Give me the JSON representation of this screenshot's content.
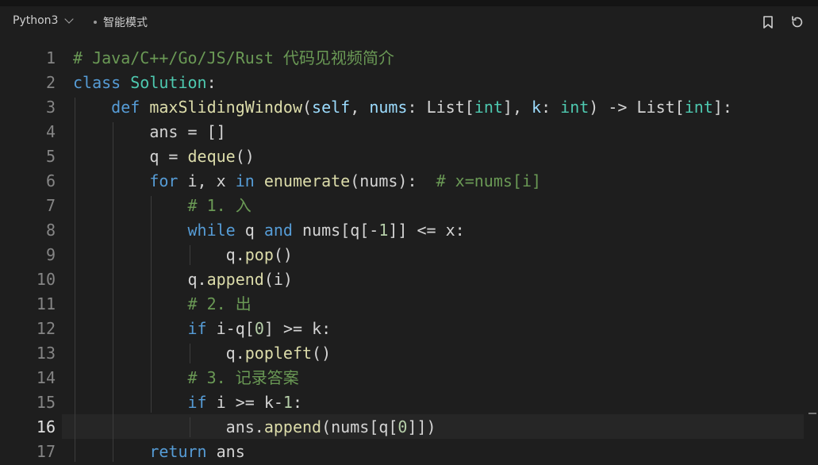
{
  "toolbar": {
    "language": "Python3",
    "mode": "智能模式",
    "bookmark_icon": "bookmark-icon",
    "reset_icon": "reset-icon"
  },
  "editor": {
    "active_line": 16,
    "lines": [
      {
        "n": "1",
        "tokens": [
          {
            "t": "# Java/C++/Go/JS/Rust 代码见视频简介",
            "c": "cm"
          }
        ]
      },
      {
        "n": "2",
        "tokens": [
          {
            "t": "class ",
            "c": "kw"
          },
          {
            "t": "Solution",
            "c": "cls"
          },
          {
            "t": ":",
            "c": ""
          }
        ]
      },
      {
        "n": "3",
        "tokens": [
          {
            "t": "    ",
            "c": ""
          },
          {
            "t": "def ",
            "c": "kw"
          },
          {
            "t": "maxSlidingWindow",
            "c": "fn"
          },
          {
            "t": "(",
            "c": ""
          },
          {
            "t": "self",
            "c": "self"
          },
          {
            "t": ", ",
            "c": ""
          },
          {
            "t": "nums",
            "c": "param"
          },
          {
            "t": ": List[",
            "c": ""
          },
          {
            "t": "int",
            "c": "typ"
          },
          {
            "t": "], ",
            "c": ""
          },
          {
            "t": "k",
            "c": "param"
          },
          {
            "t": ": ",
            "c": ""
          },
          {
            "t": "int",
            "c": "typ"
          },
          {
            "t": ") -> List[",
            "c": ""
          },
          {
            "t": "int",
            "c": "typ"
          },
          {
            "t": "]:",
            "c": ""
          }
        ]
      },
      {
        "n": "4",
        "tokens": [
          {
            "t": "        ans = []",
            "c": ""
          }
        ]
      },
      {
        "n": "5",
        "tokens": [
          {
            "t": "        q = ",
            "c": ""
          },
          {
            "t": "deque",
            "c": "fn"
          },
          {
            "t": "()",
            "c": ""
          }
        ]
      },
      {
        "n": "6",
        "tokens": [
          {
            "t": "        ",
            "c": ""
          },
          {
            "t": "for",
            "c": "kw"
          },
          {
            "t": " i, x ",
            "c": ""
          },
          {
            "t": "in",
            "c": "kw"
          },
          {
            "t": " ",
            "c": ""
          },
          {
            "t": "enumerate",
            "c": "fn"
          },
          {
            "t": "(nums):  ",
            "c": ""
          },
          {
            "t": "# x=nums[i]",
            "c": "cm"
          }
        ]
      },
      {
        "n": "7",
        "tokens": [
          {
            "t": "            ",
            "c": ""
          },
          {
            "t": "# 1. 入",
            "c": "cm"
          }
        ]
      },
      {
        "n": "8",
        "tokens": [
          {
            "t": "            ",
            "c": ""
          },
          {
            "t": "while",
            "c": "kw"
          },
          {
            "t": " q ",
            "c": ""
          },
          {
            "t": "and",
            "c": "kw"
          },
          {
            "t": " nums[q[-",
            "c": ""
          },
          {
            "t": "1",
            "c": "nm"
          },
          {
            "t": "]] <= x:",
            "c": ""
          }
        ]
      },
      {
        "n": "9",
        "tokens": [
          {
            "t": "                q.",
            "c": ""
          },
          {
            "t": "pop",
            "c": "fn"
          },
          {
            "t": "()",
            "c": ""
          }
        ]
      },
      {
        "n": "10",
        "tokens": [
          {
            "t": "            q.",
            "c": ""
          },
          {
            "t": "append",
            "c": "fn"
          },
          {
            "t": "(i)",
            "c": ""
          }
        ]
      },
      {
        "n": "11",
        "tokens": [
          {
            "t": "            ",
            "c": ""
          },
          {
            "t": "# 2. 出",
            "c": "cm"
          }
        ]
      },
      {
        "n": "12",
        "tokens": [
          {
            "t": "            ",
            "c": ""
          },
          {
            "t": "if",
            "c": "kw"
          },
          {
            "t": " i-q[",
            "c": ""
          },
          {
            "t": "0",
            "c": "nm"
          },
          {
            "t": "] >= k:",
            "c": ""
          }
        ]
      },
      {
        "n": "13",
        "tokens": [
          {
            "t": "                q.",
            "c": ""
          },
          {
            "t": "popleft",
            "c": "fn"
          },
          {
            "t": "()",
            "c": ""
          }
        ]
      },
      {
        "n": "14",
        "tokens": [
          {
            "t": "            ",
            "c": ""
          },
          {
            "t": "# 3. 记录答案",
            "c": "cm"
          }
        ]
      },
      {
        "n": "15",
        "tokens": [
          {
            "t": "            ",
            "c": ""
          },
          {
            "t": "if",
            "c": "kw"
          },
          {
            "t": " i >= k-",
            "c": ""
          },
          {
            "t": "1",
            "c": "nm"
          },
          {
            "t": ":",
            "c": ""
          }
        ]
      },
      {
        "n": "16",
        "tokens": [
          {
            "t": "                ans.",
            "c": ""
          },
          {
            "t": "append",
            "c": "fn"
          },
          {
            "t": "(nums[q[",
            "c": ""
          },
          {
            "t": "0",
            "c": "nm"
          },
          {
            "t": "]])",
            "c": ""
          }
        ]
      },
      {
        "n": "17",
        "tokens": [
          {
            "t": "        ",
            "c": ""
          },
          {
            "t": "return",
            "c": "kw"
          },
          {
            "t": " ans",
            "c": ""
          }
        ]
      }
    ]
  }
}
